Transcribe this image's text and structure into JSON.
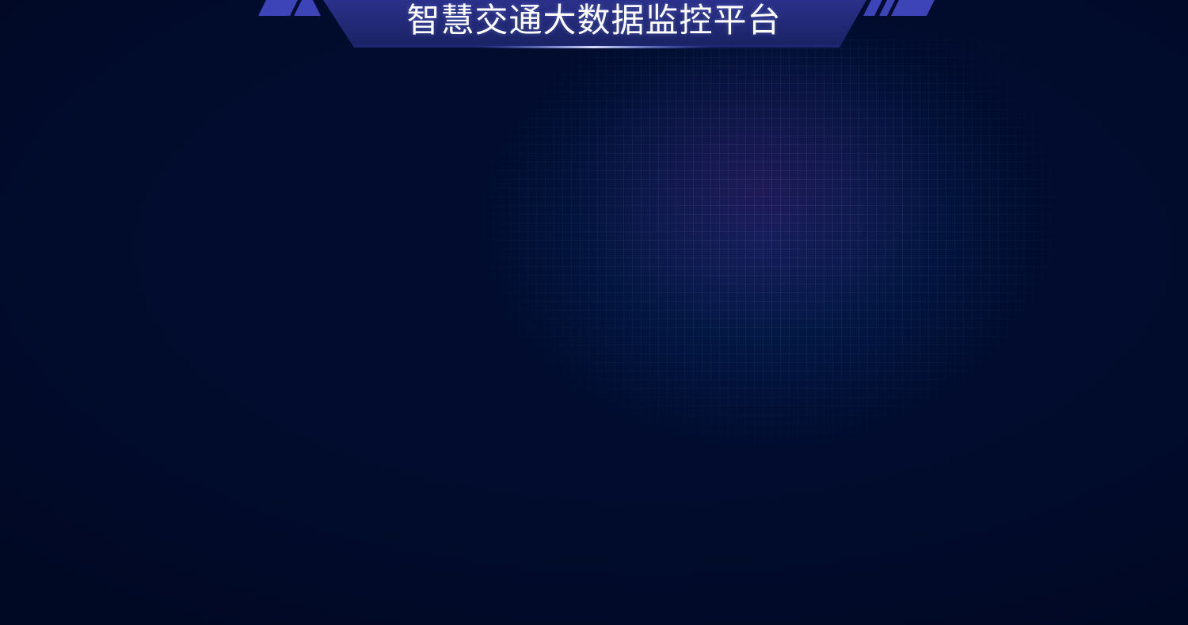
{
  "header": {
    "title": "智慧交通大数据监控平台"
  },
  "theme": {
    "background": "#010c2e",
    "header_panel": "#27307f",
    "accent_stripes": "#3d44b8",
    "glow_line": "#b8c4ff",
    "title_color": "#ffffff"
  }
}
